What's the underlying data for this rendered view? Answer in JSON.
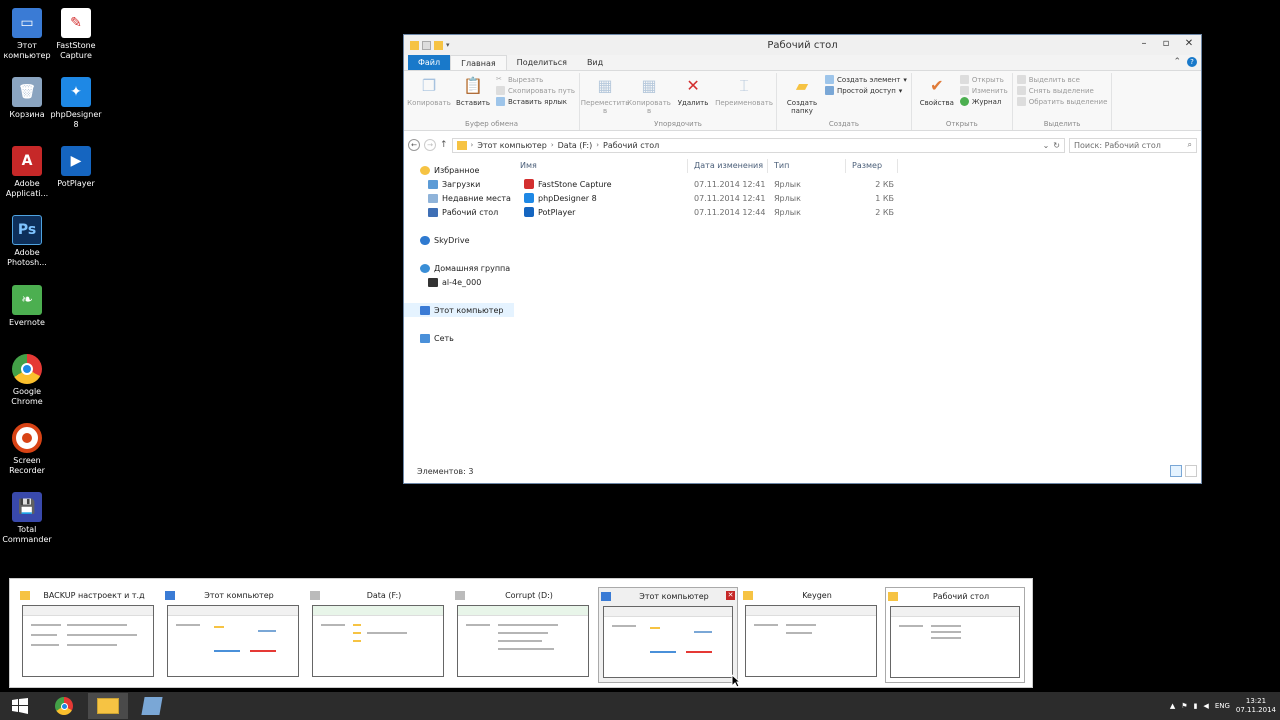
{
  "desktop": {
    "icons": [
      {
        "label": "Этот компьютер",
        "icon": "computer-icon",
        "color": "#3a7bd5"
      },
      {
        "label": "FastStone Capture",
        "icon": "faststone-icon",
        "color": "#d32f2f"
      },
      {
        "label": "Корзина",
        "icon": "recycle-bin-icon",
        "color": "#8aa4c0"
      },
      {
        "label": "phpDesigner 8",
        "icon": "phpdesigner-icon",
        "color": "#1e88e5"
      },
      {
        "label": "Adobe Applicati...",
        "icon": "adobe-icon",
        "color": "#c62828"
      },
      {
        "label": "PotPlayer",
        "icon": "potplayer-icon",
        "color": "#1565c0"
      },
      {
        "label": "Adobe Photosh...",
        "icon": "photoshop-icon",
        "color": "#0d47a1"
      },
      {
        "label": "Evernote",
        "icon": "evernote-icon",
        "color": "#4caf50"
      },
      {
        "label": "Google Chrome",
        "icon": "chrome-icon",
        "color": "#e53935"
      },
      {
        "label": "Screen Recorder",
        "icon": "screen-recorder-icon",
        "color": "#d84315"
      },
      {
        "label": "Total Commander",
        "icon": "total-commander-icon",
        "color": "#3949ab"
      }
    ]
  },
  "window": {
    "title": "Рабочий стол",
    "tabs": {
      "file": "Файл",
      "home": "Главная",
      "share": "Поделиться",
      "view": "Вид"
    },
    "ribbon": {
      "clipboard": {
        "name": "Буфер обмена",
        "copy": "Копировать",
        "paste": "Вставить",
        "cut": "Вырезать",
        "copy_path": "Скопировать путь",
        "paste_shortcut": "Вставить ярлык"
      },
      "organize": {
        "name": "Упорядочить",
        "move_to": "Переместить в",
        "copy_to": "Копировать в",
        "delete": "Удалить",
        "rename": "Переименовать"
      },
      "new": {
        "name": "Создать",
        "new_folder": "Создать папку",
        "new_item": "Создать элемент",
        "easy_access": "Простой доступ"
      },
      "open": {
        "name": "Открыть",
        "properties": "Свойства",
        "open": "Открыть",
        "edit": "Изменить",
        "history": "Журнал"
      },
      "select": {
        "name": "Выделить",
        "select_all": "Выделить все",
        "select_none": "Снять выделение",
        "invert": "Обратить выделение"
      }
    },
    "address": {
      "parts": [
        "Этот компьютер",
        "Data (F:)",
        "Рабочий стол"
      ],
      "search_placeholder": "Поиск: Рабочий стол"
    },
    "nav": {
      "favorites": "Избранное",
      "downloads": "Загрузки",
      "recent": "Недавние места",
      "desktop": "Рабочий стол",
      "skydrive": "SkyDrive",
      "homegroup": "Домашняя группа",
      "user": "al-4e_000",
      "this_pc": "Этот компьютер",
      "network": "Сеть"
    },
    "columns": {
      "name": "Имя",
      "date": "Дата изменения",
      "type": "Тип",
      "size": "Размер"
    },
    "files": [
      {
        "name": "FastStone Capture",
        "date": "07.11.2014 12:41",
        "type": "Ярлык",
        "size": "2 КБ",
        "color": "#d32f2f"
      },
      {
        "name": "phpDesigner 8",
        "date": "07.11.2014 12:41",
        "type": "Ярлык",
        "size": "1 КБ",
        "color": "#1e88e5"
      },
      {
        "name": "PotPlayer",
        "date": "07.11.2014 12:44",
        "type": "Ярлык",
        "size": "2 КБ",
        "color": "#1565c0"
      }
    ],
    "status": "Элементов: 3"
  },
  "switcher": {
    "items": [
      {
        "title": "BACKUP настроект и т.д",
        "icon": "folder-icon"
      },
      {
        "title": "Этот компьютер",
        "icon": "computer-icon"
      },
      {
        "title": "Data (F:)",
        "icon": "drive-icon"
      },
      {
        "title": "Corrupt (D:)",
        "icon": "drive-icon"
      },
      {
        "title": "Этот компьютер",
        "icon": "computer-icon"
      },
      {
        "title": "Keygen",
        "icon": "folder-icon"
      },
      {
        "title": "Рабочий стол",
        "icon": "folder-icon"
      }
    ],
    "close_glyph": "✕"
  },
  "taskbar": {
    "lang": "ENG",
    "time": "13:21",
    "date": "07.11.2014"
  }
}
